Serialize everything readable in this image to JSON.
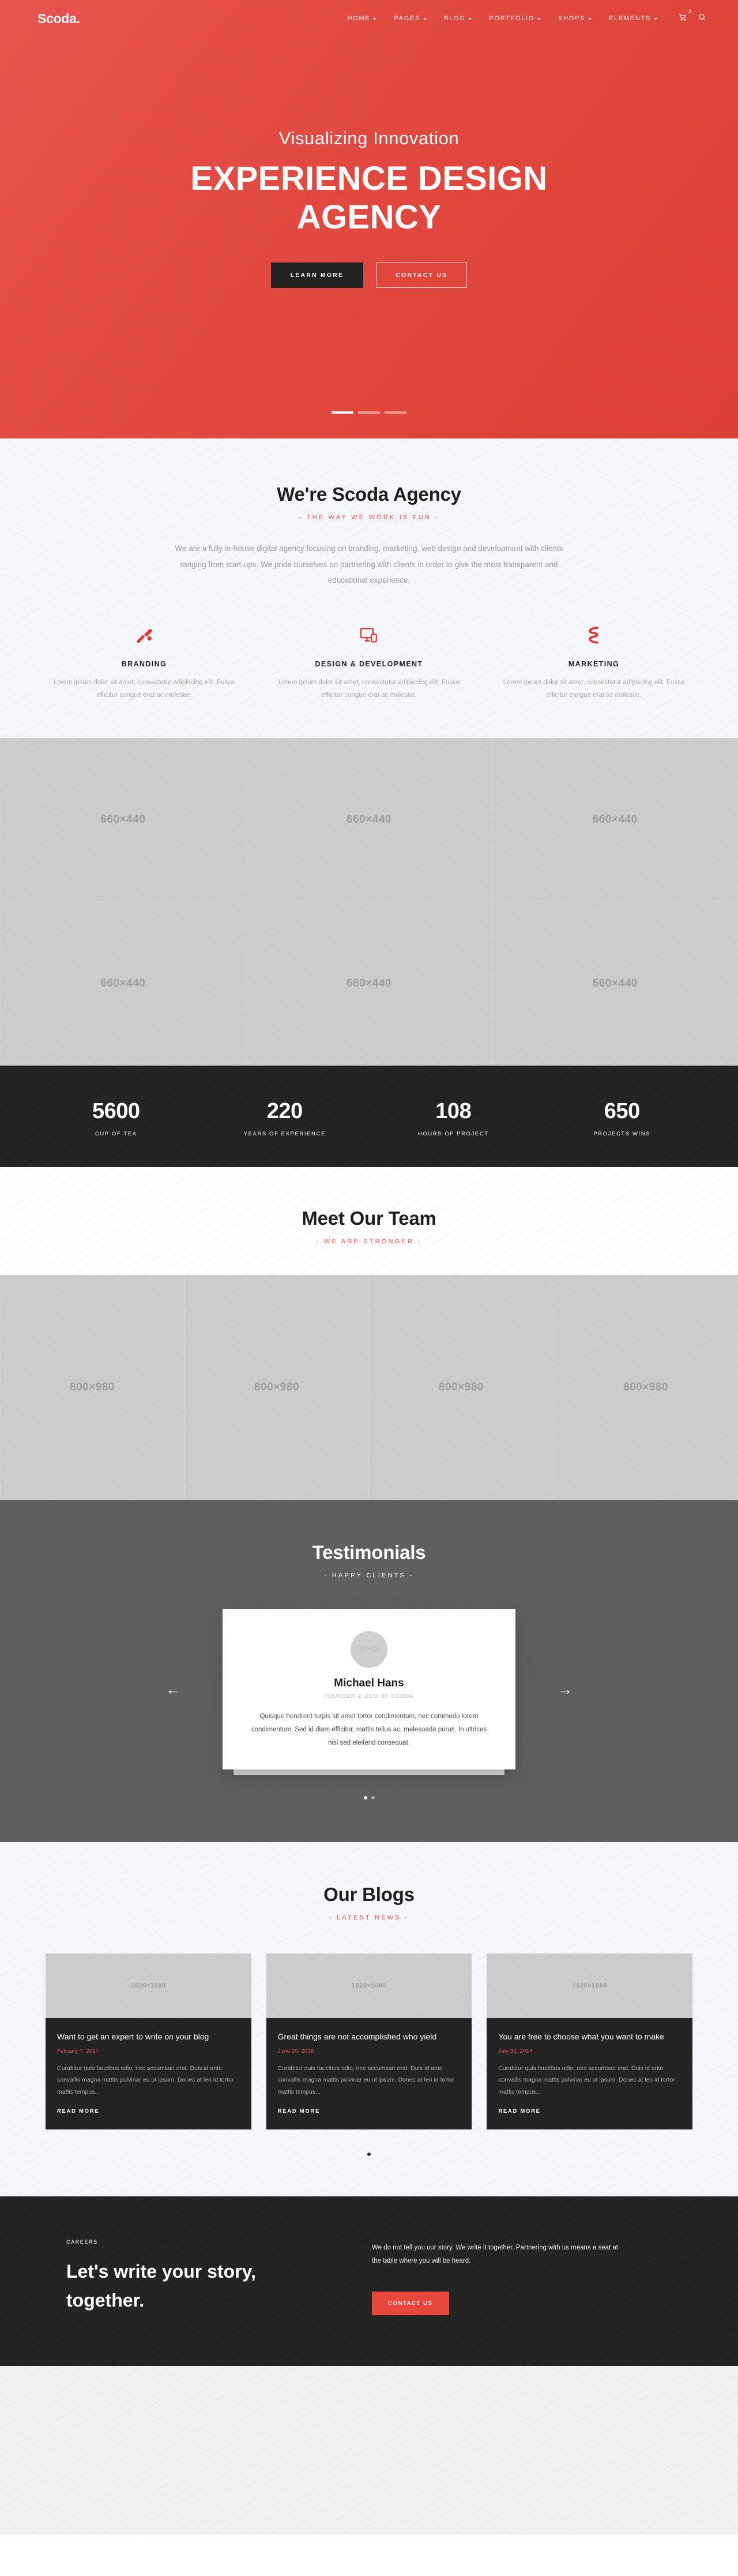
{
  "header": {
    "brand": "Scoda.",
    "nav": [
      {
        "label": "HOME",
        "caret": true
      },
      {
        "label": "PAGES",
        "caret": true
      },
      {
        "label": "BLOG",
        "caret": true
      },
      {
        "label": "PORTFOLIO",
        "caret": true
      },
      {
        "label": "SHOPS",
        "caret": true
      },
      {
        "label": "ELEMENTS",
        "caret": true
      }
    ],
    "cart_icon": "cart-icon",
    "cart_count": "3",
    "search_icon": "search-icon"
  },
  "hero": {
    "subtitle": "Visualizing Innovation",
    "title": "EXPERIENCE DESIGN AGENCY",
    "primary_button": "LEARN MORE",
    "secondary_button": "CONTACT US",
    "slides": 3,
    "active_slide": 0,
    "background_color": "#e1483f"
  },
  "about": {
    "title": "We're Scoda Agency",
    "kicker": "- THE WAY WE WORK IS FUN -",
    "lead": "We are a fully in-house digital agency focusing on branding, marketing, web design and development with clients ranging from start-ups. We pride ourselves on partnering with clients in order to give the most transparent and educational experience.",
    "services": [
      {
        "icon": "paintbrush-icon",
        "name": "BRANDING",
        "text": "Lorem ipsum dolor sit amet, consectetur adipiscing elit. Fusce efficitur congue erat ac molestie."
      },
      {
        "icon": "monitor-icon",
        "name": "DESIGN & DEVELOPMENT",
        "text": "Lorem ipsum dolor sit amet, consectetur adipiscing elit. Fusce efficitur congue erat ac molestie."
      },
      {
        "icon": "ribbon-icon",
        "name": "MARKETING",
        "text": "Lorem ipsum dolor sit amet, consectetur adipiscing elit. Fusce efficitur congue erat ac molestie."
      }
    ]
  },
  "portfolio": {
    "items": [
      {
        "label": "660×440"
      },
      {
        "label": "660×440"
      },
      {
        "label": "660×440"
      },
      {
        "label": "660×440"
      },
      {
        "label": "660×440"
      },
      {
        "label": "660×440"
      }
    ]
  },
  "stats": [
    {
      "value": "5600",
      "label": "CUP OF TEA"
    },
    {
      "value": "220",
      "label": "YEARS OF EXPERIENCE"
    },
    {
      "value": "108",
      "label": "HOURS OF PROJECT"
    },
    {
      "value": "650",
      "label": "PROJECTS WINS"
    }
  ],
  "team": {
    "title": "Meet Our Team",
    "kicker": "- WE ARE STRONGER -",
    "members": [
      {
        "label": "800×980"
      },
      {
        "label": "800×980"
      },
      {
        "label": "800×980"
      },
      {
        "label": "800×980"
      }
    ]
  },
  "testimonials": {
    "title": "Testimonials",
    "kicker": "- HAPPY CLIENTS -",
    "prev_icon": "arrow-left-icon",
    "next_icon": "arrow-right-icon",
    "active_dot": 0,
    "dots": 2,
    "card": {
      "avatar_label": "120×120",
      "name": "Michael Hans",
      "role": "FOUNDER & CEO OF SCODA",
      "quote": "Quisque hendrerit turpis sit amet tortor condimentum, nec commodo lorem condimentum. Sed id diam efficitur, mattis tellus ac, malesuada purus. In ultrices nisl sed eleifend consequat."
    }
  },
  "blogs": {
    "title": "Our Blogs",
    "kicker": "- LATEST NEWS -",
    "posts": [
      {
        "image_label": "1620×1080",
        "title": "Want to get an expert to write on your blog",
        "date": "Febuary 7, 2017",
        "excerpt": "Curabitur quis faucibus odio, nec accumsan erat. Duis id ante convallis magna mattis pulvinar eu ut ipsum. Donec at leo id tortor mattis tempus...",
        "more": "READ MORE"
      },
      {
        "image_label": "1620×1080",
        "title": "Great things are not accomplished who yield",
        "date": "June 20, 2016",
        "excerpt": "Curabitur quis faucibus odio, nec accumsan erat. Duis id ante convallis magna mattis pulvinar eu ut ipsum. Donec at leo id tortor mattis tempus...",
        "more": "READ MORE"
      },
      {
        "image_label": "1620×1080",
        "title": "You are free to choose what you want to make",
        "date": "July 30, 2014",
        "excerpt": "Curabitur quis faucibus odio, nec accumsan erat. Duis id ante convallis magna mattis pulvinar eu ut ipsum. Donec at leo id tortor mattis tempus...",
        "more": "READ MORE"
      }
    ]
  },
  "cta": {
    "kicker": "CAREERS",
    "title": "Let's write your story, together.",
    "text": "We do not tell you our story. We write it together. Partnering with us means a seat at the table where you will be heard.",
    "button": "CONTACT US",
    "button_color": "#e8473c"
  }
}
